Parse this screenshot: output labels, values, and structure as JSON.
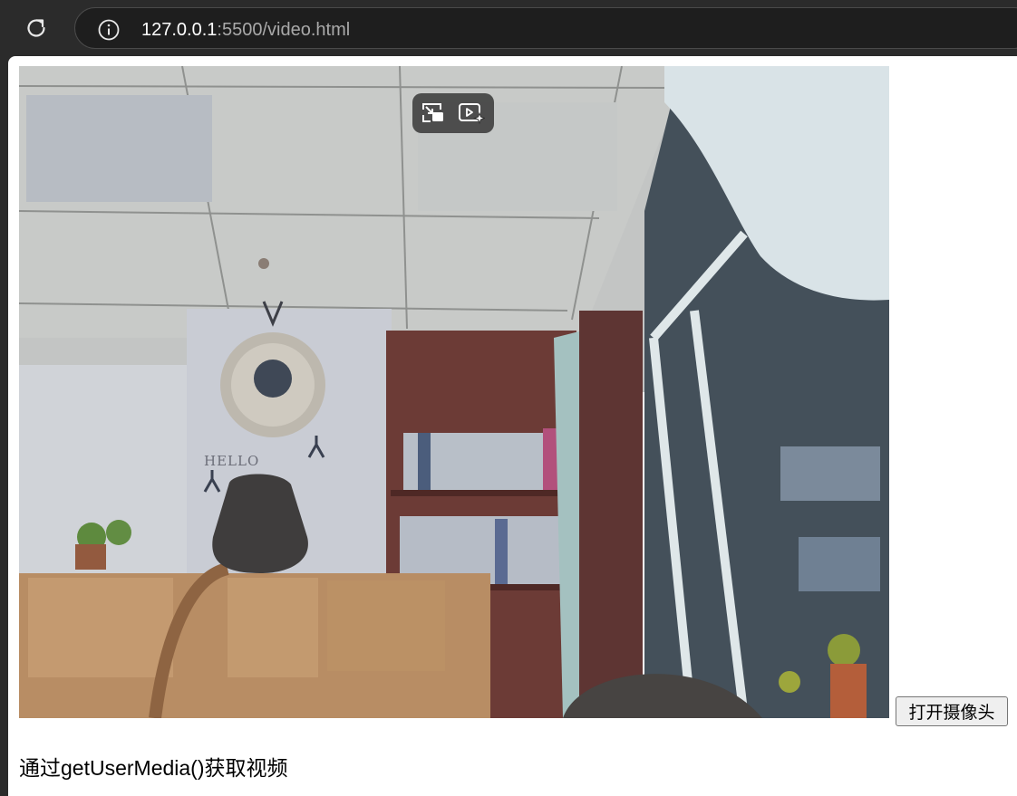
{
  "browser": {
    "url_host": "127.0.0.1",
    "url_rest": ":5500/video.html",
    "icons": {
      "reload": "reload-icon",
      "site_info": "info-icon"
    }
  },
  "video": {
    "overlay_icons": [
      "picture-in-picture-icon",
      "video-effects-icon"
    ],
    "wall_text": "HELLO"
  },
  "page": {
    "open_camera_button": "打开摄像头",
    "caption": "通过getUserMedia()获取视频"
  }
}
